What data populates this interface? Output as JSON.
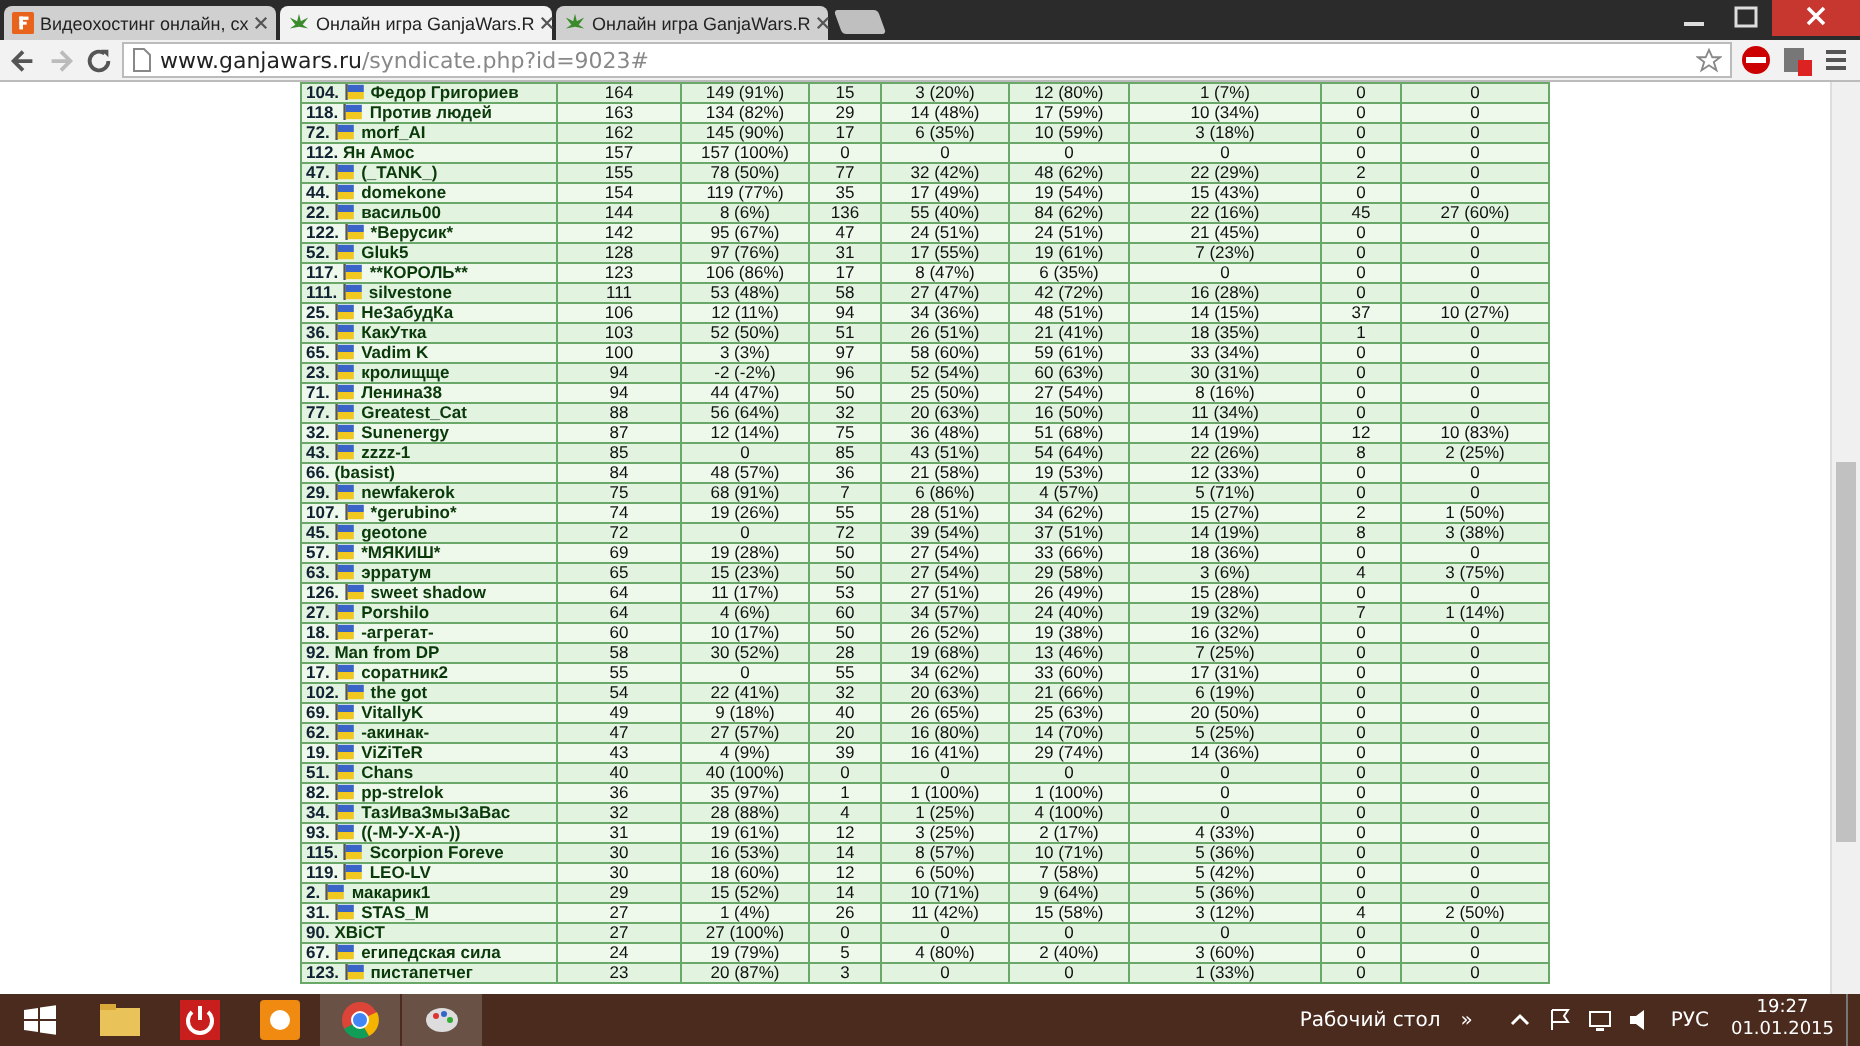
{
  "tabs": [
    {
      "title": "Видеохостинг онлайн, сх",
      "selected": false
    },
    {
      "title": "Онлайн игра GanjaWars.R",
      "selected": true
    },
    {
      "title": "Онлайн игра GanjaWars.R",
      "selected": false
    }
  ],
  "address": {
    "host": "www.ganjawars.ru",
    "path": "/syndicate.php?id=9023#"
  },
  "rows": [
    {
      "rank": "104.",
      "flag": true,
      "name": "Федор Григориев",
      "cells": [
        "164",
        "149 (91%)",
        "15",
        "3 (20%)",
        "12 (80%)",
        "1 (7%)",
        "0",
        "0"
      ]
    },
    {
      "rank": "118.",
      "flag": true,
      "name": "Против людей",
      "cells": [
        "163",
        "134 (82%)",
        "29",
        "14 (48%)",
        "17 (59%)",
        "10 (34%)",
        "0",
        "0"
      ]
    },
    {
      "rank": "72.",
      "flag": true,
      "name": "morf_AI",
      "cells": [
        "162",
        "145 (90%)",
        "17",
        "6 (35%)",
        "10 (59%)",
        "3 (18%)",
        "0",
        "0"
      ]
    },
    {
      "rank": "112.",
      "flag": false,
      "name": "Ян Амос",
      "cells": [
        "157",
        "157 (100%)",
        "0",
        "0",
        "0",
        "0",
        "0",
        "0"
      ]
    },
    {
      "rank": "47.",
      "flag": true,
      "name": "(_TANK_)",
      "cells": [
        "155",
        "78 (50%)",
        "77",
        "32 (42%)",
        "48 (62%)",
        "22 (29%)",
        "2",
        "0"
      ]
    },
    {
      "rank": "44.",
      "flag": true,
      "name": "domekone",
      "cells": [
        "154",
        "119 (77%)",
        "35",
        "17 (49%)",
        "19 (54%)",
        "15 (43%)",
        "0",
        "0"
      ]
    },
    {
      "rank": "22.",
      "flag": true,
      "name": "василь00",
      "cells": [
        "144",
        "8 (6%)",
        "136",
        "55 (40%)",
        "84 (62%)",
        "22 (16%)",
        "45",
        "27 (60%)"
      ]
    },
    {
      "rank": "122.",
      "flag": true,
      "name": "*Верусик*",
      "cells": [
        "142",
        "95 (67%)",
        "47",
        "24 (51%)",
        "24 (51%)",
        "21 (45%)",
        "0",
        "0"
      ]
    },
    {
      "rank": "52.",
      "flag": true,
      "name": "Gluk5",
      "cells": [
        "128",
        "97 (76%)",
        "31",
        "17 (55%)",
        "19 (61%)",
        "7 (23%)",
        "0",
        "0"
      ]
    },
    {
      "rank": "117.",
      "flag": true,
      "name": "**КОРОЛЬ**",
      "cells": [
        "123",
        "106 (86%)",
        "17",
        "8 (47%)",
        "6 (35%)",
        "0",
        "0",
        "0"
      ]
    },
    {
      "rank": "111.",
      "flag": true,
      "name": "silvestone",
      "cells": [
        "111",
        "53 (48%)",
        "58",
        "27 (47%)",
        "42 (72%)",
        "16 (28%)",
        "0",
        "0"
      ]
    },
    {
      "rank": "25.",
      "flag": true,
      "name": "НеЗабудКа",
      "cells": [
        "106",
        "12 (11%)",
        "94",
        "34 (36%)",
        "48 (51%)",
        "14 (15%)",
        "37",
        "10 (27%)"
      ]
    },
    {
      "rank": "36.",
      "flag": true,
      "name": "КакУтка",
      "cells": [
        "103",
        "52 (50%)",
        "51",
        "26 (51%)",
        "21 (41%)",
        "18 (35%)",
        "1",
        "0"
      ]
    },
    {
      "rank": "65.",
      "flag": true,
      "name": "Vadim K",
      "cells": [
        "100",
        "3 (3%)",
        "97",
        "58 (60%)",
        "59 (61%)",
        "33 (34%)",
        "0",
        "0"
      ]
    },
    {
      "rank": "23.",
      "flag": true,
      "name": "кролищще",
      "cells": [
        "94",
        "-2 (-2%)",
        "96",
        "52 (54%)",
        "60 (63%)",
        "30 (31%)",
        "0",
        "0"
      ]
    },
    {
      "rank": "71.",
      "flag": true,
      "name": "Ленина38",
      "cells": [
        "94",
        "44 (47%)",
        "50",
        "25 (50%)",
        "27 (54%)",
        "8 (16%)",
        "0",
        "0"
      ]
    },
    {
      "rank": "77.",
      "flag": true,
      "name": "Greatest_Cat",
      "cells": [
        "88",
        "56 (64%)",
        "32",
        "20 (63%)",
        "16 (50%)",
        "11 (34%)",
        "0",
        "0"
      ]
    },
    {
      "rank": "32.",
      "flag": true,
      "name": "Sunenergy",
      "cells": [
        "87",
        "12 (14%)",
        "75",
        "36 (48%)",
        "51 (68%)",
        "14 (19%)",
        "12",
        "10 (83%)"
      ]
    },
    {
      "rank": "43.",
      "flag": true,
      "name": "zzzz-1",
      "cells": [
        "85",
        "0",
        "85",
        "43 (51%)",
        "54 (64%)",
        "22 (26%)",
        "8",
        "2 (25%)"
      ]
    },
    {
      "rank": "66.",
      "flag": false,
      "name": "(basist)",
      "cells": [
        "84",
        "48 (57%)",
        "36",
        "21 (58%)",
        "19 (53%)",
        "12 (33%)",
        "0",
        "0"
      ]
    },
    {
      "rank": "29.",
      "flag": true,
      "name": "newfakerok",
      "cells": [
        "75",
        "68 (91%)",
        "7",
        "6 (86%)",
        "4 (57%)",
        "5 (71%)",
        "0",
        "0"
      ]
    },
    {
      "rank": "107.",
      "flag": true,
      "name": "*gerubino*",
      "cells": [
        "74",
        "19 (26%)",
        "55",
        "28 (51%)",
        "34 (62%)",
        "15 (27%)",
        "2",
        "1 (50%)"
      ]
    },
    {
      "rank": "45.",
      "flag": true,
      "name": "geotone",
      "cells": [
        "72",
        "0",
        "72",
        "39 (54%)",
        "37 (51%)",
        "14 (19%)",
        "8",
        "3 (38%)"
      ]
    },
    {
      "rank": "57.",
      "flag": true,
      "name": "*МЯКИШ*",
      "cells": [
        "69",
        "19 (28%)",
        "50",
        "27 (54%)",
        "33 (66%)",
        "18 (36%)",
        "0",
        "0"
      ]
    },
    {
      "rank": "63.",
      "flag": true,
      "name": "эрратум",
      "cells": [
        "65",
        "15 (23%)",
        "50",
        "27 (54%)",
        "29 (58%)",
        "3 (6%)",
        "4",
        "3 (75%)"
      ]
    },
    {
      "rank": "126.",
      "flag": true,
      "name": "sweet shadow",
      "cells": [
        "64",
        "11 (17%)",
        "53",
        "27 (51%)",
        "26 (49%)",
        "15 (28%)",
        "0",
        "0"
      ]
    },
    {
      "rank": "27.",
      "flag": true,
      "name": "Porshilo",
      "cells": [
        "64",
        "4 (6%)",
        "60",
        "34 (57%)",
        "24 (40%)",
        "19 (32%)",
        "7",
        "1 (14%)"
      ]
    },
    {
      "rank": "18.",
      "flag": true,
      "name": "-агрегат-",
      "cells": [
        "60",
        "10 (17%)",
        "50",
        "26 (52%)",
        "19 (38%)",
        "16 (32%)",
        "0",
        "0"
      ]
    },
    {
      "rank": "92.",
      "flag": false,
      "name": "Man from DP",
      "cells": [
        "58",
        "30 (52%)",
        "28",
        "19 (68%)",
        "13 (46%)",
        "7 (25%)",
        "0",
        "0"
      ]
    },
    {
      "rank": "17.",
      "flag": true,
      "name": "соратник2",
      "cells": [
        "55",
        "0",
        "55",
        "34 (62%)",
        "33 (60%)",
        "17 (31%)",
        "0",
        "0"
      ]
    },
    {
      "rank": "102.",
      "flag": true,
      "name": "the got",
      "cells": [
        "54",
        "22 (41%)",
        "32",
        "20 (63%)",
        "21 (66%)",
        "6 (19%)",
        "0",
        "0"
      ]
    },
    {
      "rank": "69.",
      "flag": true,
      "name": "VitallyK",
      "cells": [
        "49",
        "9 (18%)",
        "40",
        "26 (65%)",
        "25 (63%)",
        "20 (50%)",
        "0",
        "0"
      ]
    },
    {
      "rank": "62.",
      "flag": true,
      "name": "-акинак-",
      "cells": [
        "47",
        "27 (57%)",
        "20",
        "16 (80%)",
        "14 (70%)",
        "5 (25%)",
        "0",
        "0"
      ]
    },
    {
      "rank": "19.",
      "flag": true,
      "name": "ViZiTeR",
      "cells": [
        "43",
        "4 (9%)",
        "39",
        "16 (41%)",
        "29 (74%)",
        "14 (36%)",
        "0",
        "0"
      ]
    },
    {
      "rank": "51.",
      "flag": true,
      "name": "Chans",
      "cells": [
        "40",
        "40 (100%)",
        "0",
        "0",
        "0",
        "0",
        "0",
        "0"
      ]
    },
    {
      "rank": "82.",
      "flag": true,
      "name": "pp-strelok",
      "cells": [
        "36",
        "35 (97%)",
        "1",
        "1 (100%)",
        "1 (100%)",
        "0",
        "0",
        "0"
      ]
    },
    {
      "rank": "34.",
      "flag": true,
      "name": "ТазИваЗмыЗаВас",
      "cells": [
        "32",
        "28 (88%)",
        "4",
        "1 (25%)",
        "4 (100%)",
        "0",
        "0",
        "0"
      ]
    },
    {
      "rank": "93.",
      "flag": true,
      "name": "((-М-У-Х-А-))",
      "cells": [
        "31",
        "19 (61%)",
        "12",
        "3 (25%)",
        "2 (17%)",
        "4 (33%)",
        "0",
        "0"
      ]
    },
    {
      "rank": "115.",
      "flag": true,
      "name": "Scorpion Foreve",
      "cells": [
        "30",
        "16 (53%)",
        "14",
        "8 (57%)",
        "10 (71%)",
        "5 (36%)",
        "0",
        "0"
      ]
    },
    {
      "rank": "119.",
      "flag": true,
      "name": "LEO-LV",
      "cells": [
        "30",
        "18 (60%)",
        "12",
        "6 (50%)",
        "7 (58%)",
        "5 (42%)",
        "0",
        "0"
      ]
    },
    {
      "rank": "2.",
      "flag": true,
      "name": "макарик1",
      "cells": [
        "29",
        "15 (52%)",
        "14",
        "10 (71%)",
        "9 (64%)",
        "5 (36%)",
        "0",
        "0"
      ]
    },
    {
      "rank": "31.",
      "flag": true,
      "name": "STAS_M",
      "cells": [
        "27",
        "1 (4%)",
        "26",
        "11 (42%)",
        "15 (58%)",
        "3 (12%)",
        "4",
        "2 (50%)"
      ]
    },
    {
      "rank": "90.",
      "flag": false,
      "name": "ХВіСТ",
      "cells": [
        "27",
        "27 (100%)",
        "0",
        "0",
        "0",
        "0",
        "0",
        "0"
      ]
    },
    {
      "rank": "67.",
      "flag": true,
      "name": "египедская сила",
      "cells": [
        "24",
        "19 (79%)",
        "5",
        "4 (80%)",
        "2 (40%)",
        "3 (60%)",
        "0",
        "0"
      ]
    },
    {
      "rank": "123.",
      "flag": true,
      "name": "пистапетчег",
      "cells": [
        "23",
        "20 (87%)",
        "3",
        "0",
        "0",
        "1 (33%)",
        "0",
        "0"
      ]
    }
  ],
  "taskbar": {
    "desktop_label": "Рабочий стол",
    "chevron": "»",
    "language": "РУС",
    "time": "19:27",
    "date": "01.01.2015"
  }
}
